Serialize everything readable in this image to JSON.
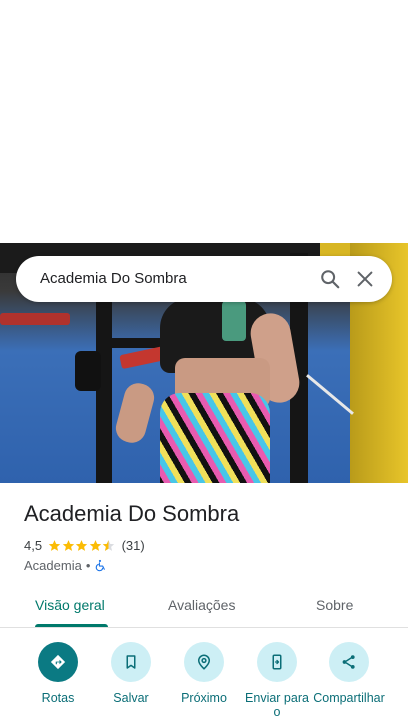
{
  "search": {
    "query": "Academia Do Sombra"
  },
  "place": {
    "name": "Academia Do Sombra",
    "rating": "4,5",
    "rating_value": 4.5,
    "reviews_count": "(31)",
    "category": "Academia",
    "separator": "•"
  },
  "tabs": [
    {
      "label": "Visão geral",
      "active": true
    },
    {
      "label": "Avaliações",
      "active": false
    },
    {
      "label": "Sobre",
      "active": false
    }
  ],
  "actions": [
    {
      "label": "Rotas",
      "icon": "directions-icon"
    },
    {
      "label": "Salvar",
      "icon": "bookmark-icon"
    },
    {
      "label": "Próximo",
      "icon": "nearby-icon"
    },
    {
      "label": "Enviar para o",
      "icon": "send-to-phone-icon"
    },
    {
      "label": "Compartilhar",
      "icon": "share-icon"
    }
  ],
  "colors": {
    "accent": "#00796b",
    "action_bg": "#cdeff5",
    "primary_action_bg": "#0b7a83",
    "star": "#fbbc04"
  }
}
